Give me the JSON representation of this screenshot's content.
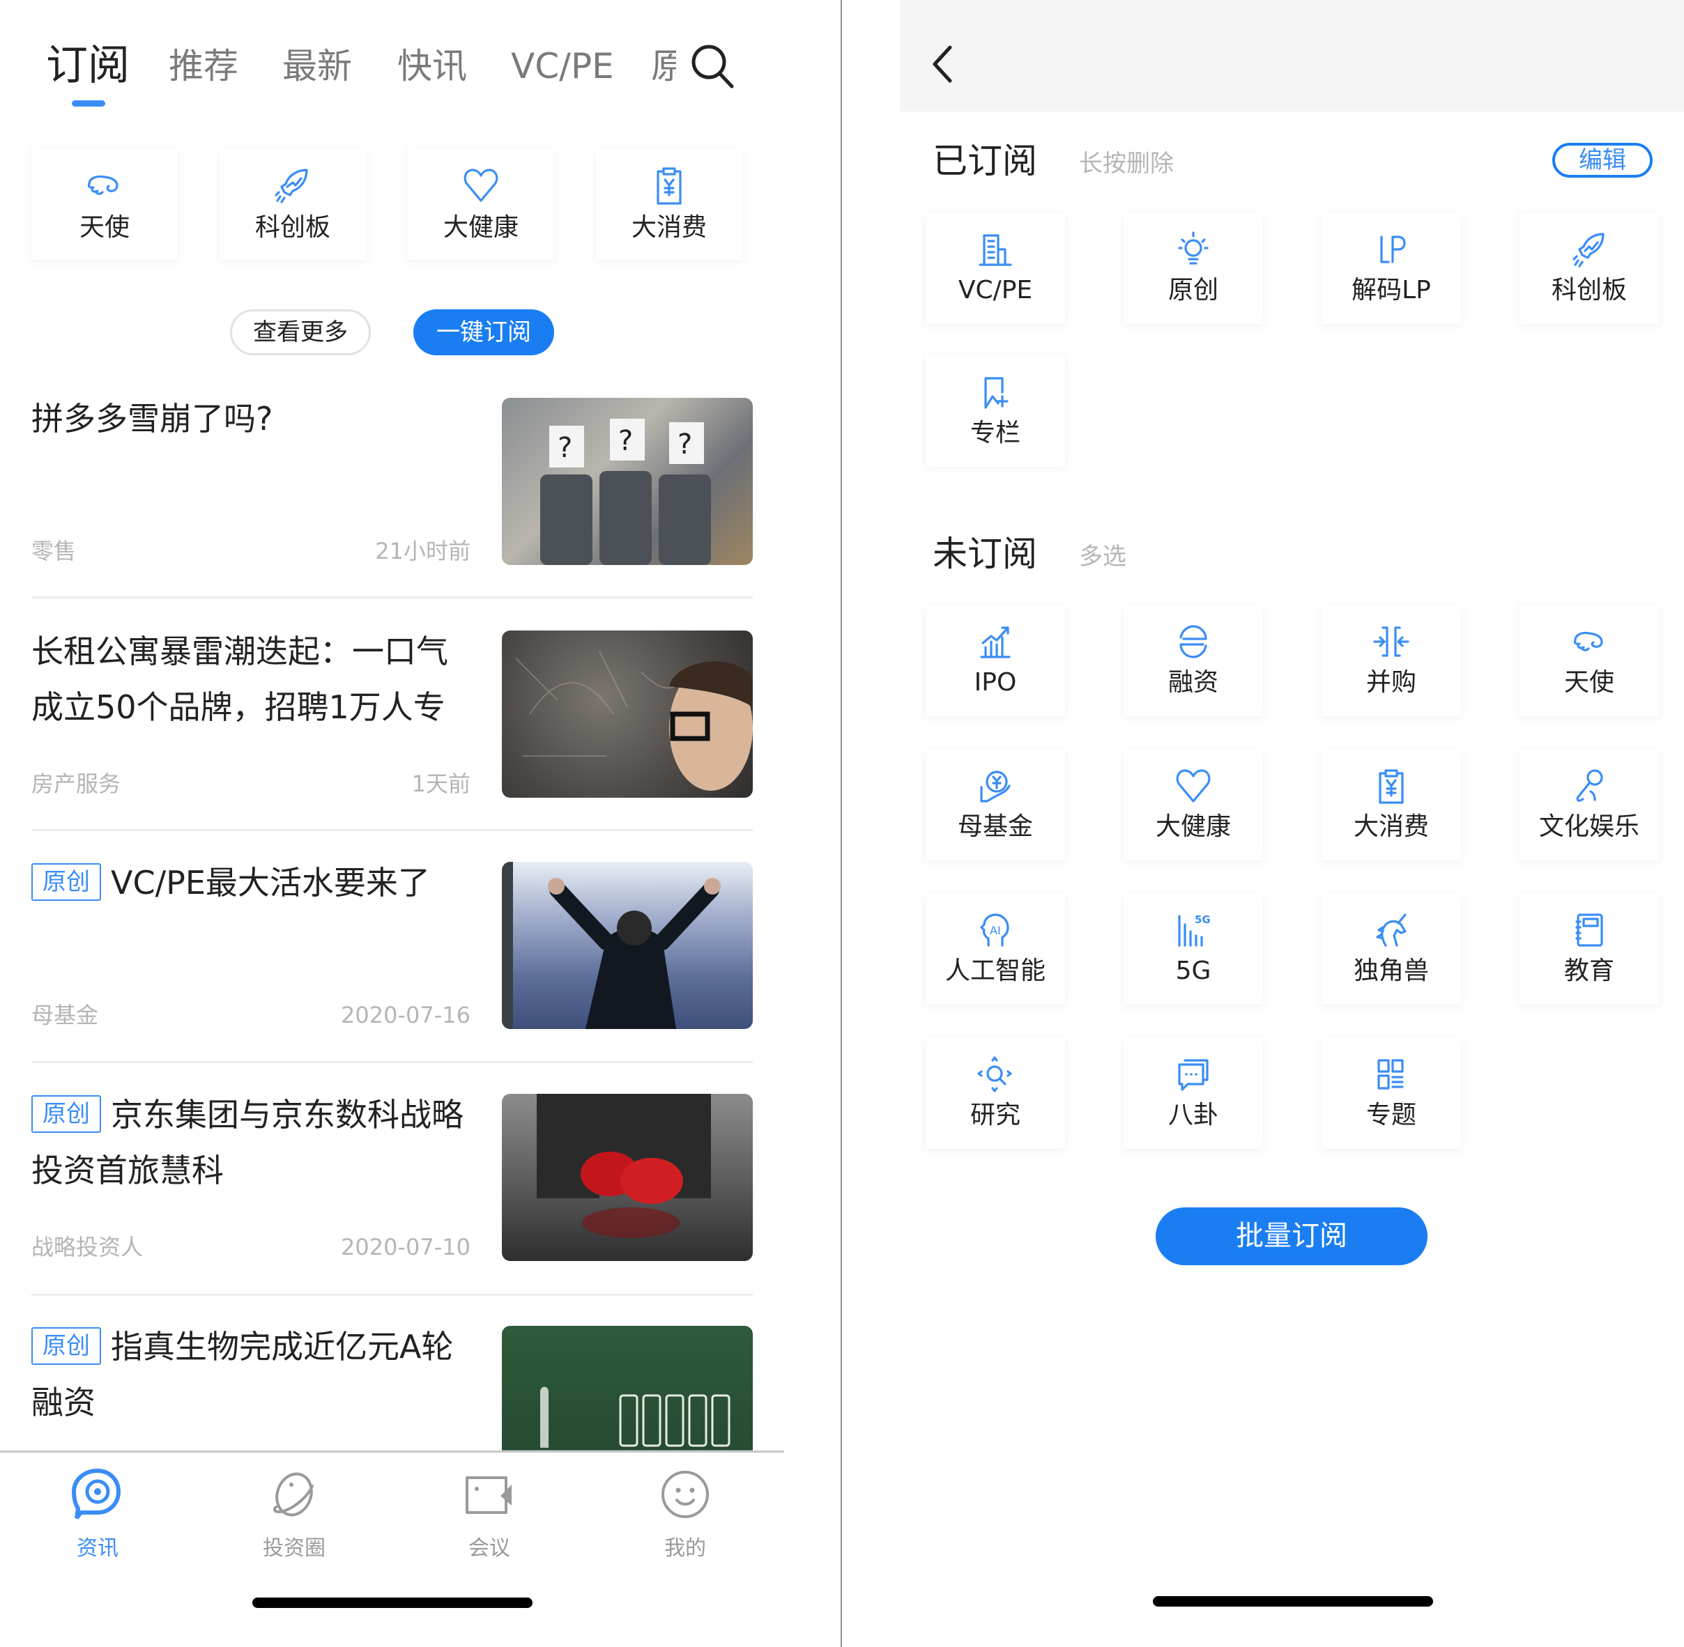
{
  "left": {
    "tabs": [
      {
        "label": "订阅",
        "active": true
      },
      {
        "label": "推荐",
        "active": false
      },
      {
        "label": "最新",
        "active": false
      },
      {
        "label": "快讯",
        "active": false
      },
      {
        "label": "VC/PE",
        "active": false
      },
      {
        "label": "原",
        "active": false
      }
    ],
    "search_icon": "search-icon",
    "quick_categories": [
      {
        "label": "天使",
        "icon": "angel-wing-icon"
      },
      {
        "label": "科创板",
        "icon": "rocket-icon"
      },
      {
        "label": "大健康",
        "icon": "heart-icon"
      },
      {
        "label": "大消费",
        "icon": "clipboard-yen-icon"
      }
    ],
    "buttons": {
      "see_more": "查看更多",
      "one_click_subscribe": "一键订阅"
    },
    "articles": [
      {
        "badge": "",
        "title": "拼多多雪崩了吗?",
        "category": "零售",
        "time": "21小时前",
        "thumb": "three-men-question-marks"
      },
      {
        "badge": "",
        "title": "长租公寓暴雷潮迭起：一口气成立50个品牌，招聘1万人专",
        "category": "房产服务",
        "time": "1天前",
        "thumb": "man-with-glasses-chalkboard"
      },
      {
        "badge": "原创",
        "title": "VC/PE最大活水要来了",
        "category": "母基金",
        "time": "2020-07-16",
        "thumb": "man-arms-raised-window"
      },
      {
        "badge": "原创",
        "title": "京东集团与京东数科战略投资首旅慧科",
        "category": "战略投资人",
        "time": "2020-07-10",
        "thumb": "boxing-gloves"
      },
      {
        "badge": "原创",
        "title": "指真生物完成近亿元A轮融资",
        "category": "",
        "time": "",
        "thumb": "chalkboard-batteries"
      }
    ],
    "tabbar": [
      {
        "label": "资讯",
        "icon": "news-chat-icon",
        "active": true
      },
      {
        "label": "投资圈",
        "icon": "planet-icon",
        "active": false
      },
      {
        "label": "会议",
        "icon": "video-camera-icon",
        "active": false
      },
      {
        "label": "我的",
        "icon": "smiley-face-icon",
        "active": false
      }
    ]
  },
  "right": {
    "back_icon": "chevron-left-icon",
    "subscribed": {
      "title": "已订阅",
      "hint": "长按删除",
      "edit_label": "编辑",
      "items": [
        {
          "label": "VC/PE",
          "icon": "building-icon"
        },
        {
          "label": "原创",
          "icon": "lightbulb-icon"
        },
        {
          "label": "解码LP",
          "icon": "lp-icon"
        },
        {
          "label": "科创板",
          "icon": "rocket-icon"
        },
        {
          "label": "专栏",
          "icon": "bookmark-plus-icon"
        }
      ]
    },
    "unsubscribed": {
      "title": "未订阅",
      "hint": "多选",
      "items": [
        {
          "label": "IPO",
          "icon": "chart-up-icon"
        },
        {
          "label": "融资",
          "icon": "financing-icon"
        },
        {
          "label": "并购",
          "icon": "merge-icon"
        },
        {
          "label": "天使",
          "icon": "angel-wing-icon"
        },
        {
          "label": "母基金",
          "icon": "hand-yen-icon"
        },
        {
          "label": "大健康",
          "icon": "heart-icon"
        },
        {
          "label": "大消费",
          "icon": "clipboard-yen-icon"
        },
        {
          "label": "文化娱乐",
          "icon": "microphone-icon"
        },
        {
          "label": "人工智能",
          "icon": "ai-head-icon"
        },
        {
          "label": "5G",
          "icon": "signal-5g-icon"
        },
        {
          "label": "独角兽",
          "icon": "unicorn-icon"
        },
        {
          "label": "教育",
          "icon": "notebook-icon"
        },
        {
          "label": "研究",
          "icon": "research-magnifier-icon"
        },
        {
          "label": "八卦",
          "icon": "chat-bubbles-icon"
        },
        {
          "label": "专题",
          "icon": "topic-grid-icon"
        }
      ]
    },
    "batch_subscribe_label": "批量订阅"
  },
  "colors": {
    "accent": "#1a7ef2",
    "icon_blue": "#3a8df5",
    "text_primary": "#222222",
    "text_secondary": "#7a7a7a",
    "text_meta": "#b5b5b5",
    "header_gray": "#f5f5f5"
  }
}
